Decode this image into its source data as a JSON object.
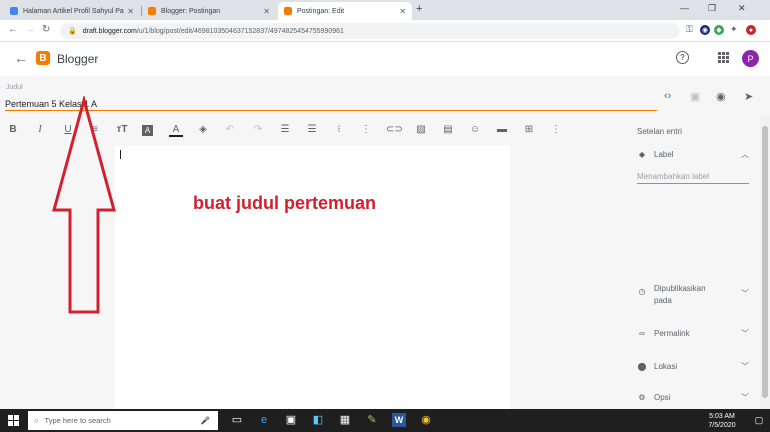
{
  "browser": {
    "tabs": [
      {
        "label": "Halaman Artikel Profil Sahyul Pa",
        "favicon_color": "#4285f4"
      },
      {
        "label": "Blogger: Postingan",
        "favicon_color": "#f57c00"
      },
      {
        "label": "Postingan: Edit",
        "favicon_color": "#f57c00"
      }
    ],
    "new_tab": "+",
    "url_host": "draft.blogger.com",
    "url_path": "/u/1/blog/post/edit/4698103504637152837/4974825454755990961"
  },
  "app": {
    "brand": "Blogger",
    "avatar_initial": "P",
    "accent_color": "#f57c00"
  },
  "editor": {
    "title_caption": "Judul",
    "title_value": "Pertemuan 5 Kelas 1 A",
    "annotation": "buat judul pertemuan"
  },
  "sidebar": {
    "heading": "Setelan entri",
    "label_section": "Label",
    "label_placeholder": "Menambahkan label",
    "published_line1": "Dipublikasikan",
    "published_line2": "pada",
    "permalink": "Permalink",
    "location": "Lokasi",
    "options": "Opsi"
  },
  "taskbar": {
    "search_placeholder": "Type here to search",
    "time": "5:03 AM",
    "date": "7/5/2020"
  }
}
